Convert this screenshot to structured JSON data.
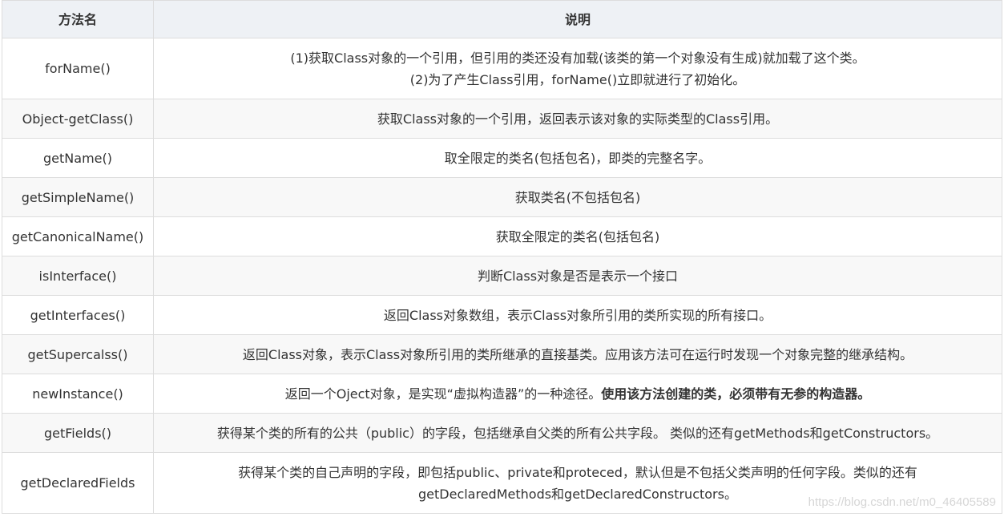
{
  "table": {
    "headers": [
      "方法名",
      "说明"
    ],
    "rows": [
      {
        "method": "forName()",
        "desc_lines": [
          "(1)获取Class对象的一个引用，但引用的类还没有加载(该类的第一个对象没有生成)就加载了这个类。",
          "(2)为了产生Class引用，forName()立即就进行了初始化。"
        ]
      },
      {
        "method": "Object-getClass()",
        "desc": "获取Class对象的一个引用，返回表示该对象的实际类型的Class引用。"
      },
      {
        "method": "getName()",
        "desc": "取全限定的类名(包括包名)，即类的完整名字。"
      },
      {
        "method": "getSimpleName()",
        "desc": "获取类名(不包括包名)"
      },
      {
        "method": "getCanonicalName()",
        "desc": "获取全限定的类名(包括包名)"
      },
      {
        "method": "isInterface()",
        "desc": "判断Class对象是否是表示一个接口"
      },
      {
        "method": "getInterfaces()",
        "desc": "返回Class对象数组，表示Class对象所引用的类所实现的所有接口。"
      },
      {
        "method": "getSupercalss()",
        "desc": "返回Class对象，表示Class对象所引用的类所继承的直接基类。应用该方法可在运行时发现一个对象完整的继承结构。"
      },
      {
        "method": "newInstance()",
        "desc_plain": "返回一个Oject对象，是实现“虚拟构造器”的一种途径。",
        "desc_bold": "使用该方法创建的类，必须带有无参的构造器。"
      },
      {
        "method": "getFields()",
        "desc": "获得某个类的所有的公共（public）的字段，包括继承自父类的所有公共字段。 类似的还有getMethods和getConstructors。"
      },
      {
        "method": "getDeclaredFields",
        "desc_lines": [
          "获得某个类的自己声明的字段，即包括public、private和proteced，默认但是不包括父类声明的任何字段。类似的还有",
          "getDeclaredMethods和getDeclaredConstructors。"
        ]
      }
    ]
  },
  "watermark": "https://blog.csdn.net/m0_46405589"
}
